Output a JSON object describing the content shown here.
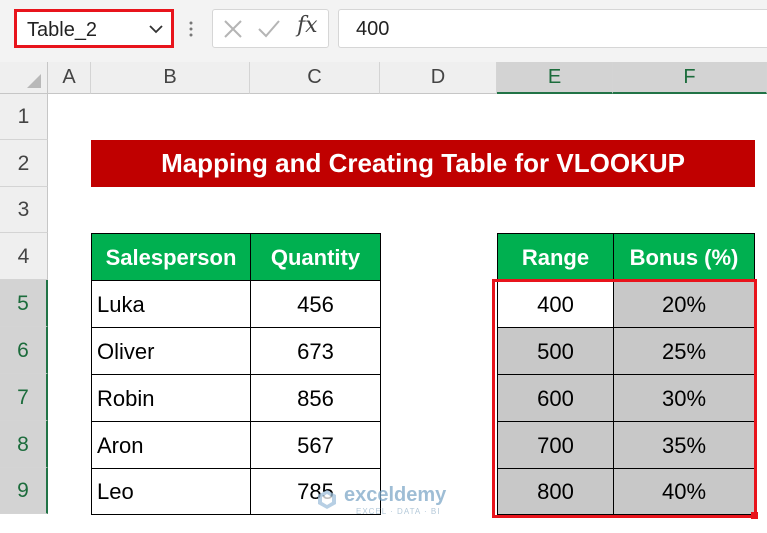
{
  "name_box": {
    "value": "Table_2"
  },
  "formula_bar": {
    "fx_label": "fx",
    "value": "400"
  },
  "columns": [
    "A",
    "B",
    "C",
    "D",
    "E",
    "F"
  ],
  "rows": [
    "1",
    "2",
    "3",
    "4",
    "5",
    "6",
    "7",
    "8",
    "9"
  ],
  "selected_columns": [
    "E",
    "F"
  ],
  "selected_rows": [
    "5",
    "6",
    "7",
    "8",
    "9"
  ],
  "title": "Mapping and Creating Table for VLOOKUP",
  "sales_table": {
    "headers": [
      "Salesperson",
      "Quantity"
    ],
    "rows": [
      [
        "Luka",
        "456"
      ],
      [
        "Oliver",
        "673"
      ],
      [
        "Robin",
        "856"
      ],
      [
        "Aron",
        "567"
      ],
      [
        "Leo",
        "785"
      ]
    ]
  },
  "bonus_table": {
    "headers": [
      "Range",
      "Bonus (%)"
    ],
    "rows": [
      [
        "400",
        "20%"
      ],
      [
        "500",
        "25%"
      ],
      [
        "600",
        "30%"
      ],
      [
        "700",
        "35%"
      ],
      [
        "800",
        "40%"
      ]
    ]
  },
  "watermark": {
    "name": "exceldemy",
    "tagline": "EXCEL · DATA · BI"
  },
  "colors": {
    "title_bg": "#c00000",
    "header_bg": "#00b050",
    "selection_border": "#e8141c",
    "selected_fill": "#c8c8c8",
    "excel_green": "#217346"
  }
}
